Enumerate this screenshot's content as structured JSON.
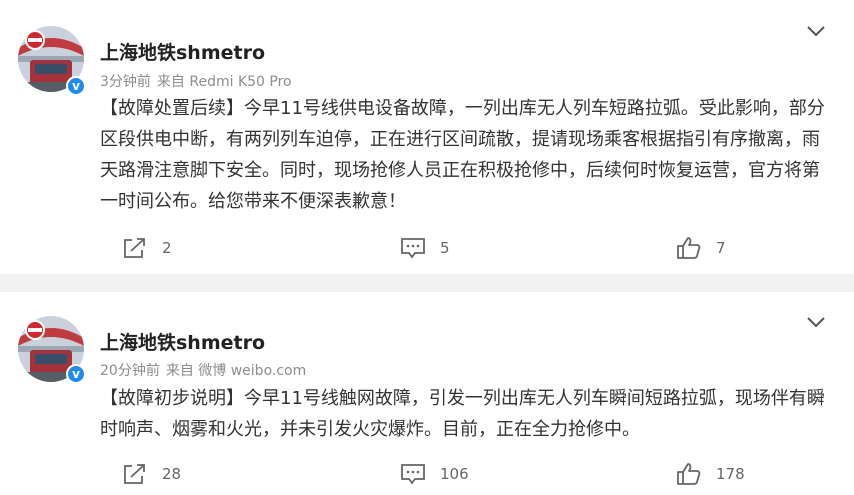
{
  "posts": [
    {
      "username": "上海地铁shmetro",
      "time": "3分钟前",
      "source": "来自 Redmi K50 Pro",
      "content": "【故障处置后续】今早11号线供电设备故障，一列出库无人列车短路拉弧。受此影响，部分区段供电中断，有两列列车迫停，正在进行区间疏散，提请现场乘客根据指引有序撤离，雨天路滑注意脚下安全。同时，现场抢修人员正在积极抢修中，后续何时恢复运营，官方将第一时间公布。给您带来不便深表歉意！",
      "reposts": "2",
      "comments": "5",
      "likes": "7"
    },
    {
      "username": "上海地铁shmetro",
      "time": "20分钟前",
      "source": "来自 微博 weibo.com",
      "content": "【故障初步说明】今早11号线触网故障，引发一列出库无人列车瞬间短路拉弧，现场伴有瞬时响声、烟雾和火光，并未引发火灾爆炸。目前，正在全力抢修中。",
      "reposts": "28",
      "comments": "106",
      "likes": "178"
    }
  ],
  "colors": {
    "accent_blue": "#1d8cf0",
    "logo_red": "#d6262b",
    "text": "#333333",
    "meta": "#8d8d8d"
  },
  "icons": [
    "repost-icon",
    "comment-icon",
    "like-icon",
    "chevron-down-icon",
    "verified-icon"
  ]
}
